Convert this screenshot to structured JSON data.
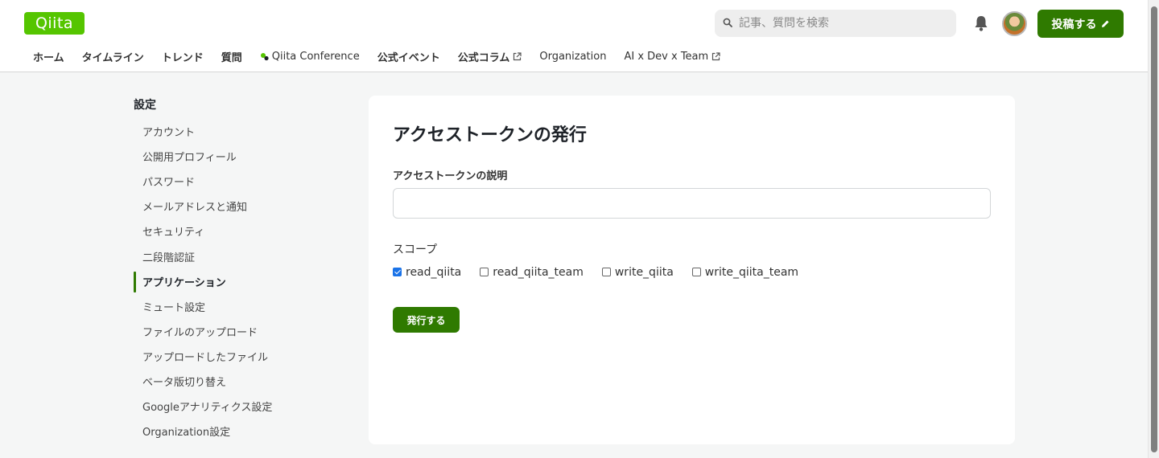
{
  "header": {
    "logo": "Qiita",
    "search_placeholder": "記事、質問を検索",
    "post_button_label": "投稿する"
  },
  "nav": {
    "items": [
      {
        "label": "ホーム"
      },
      {
        "label": "タイムライン"
      },
      {
        "label": "トレンド"
      },
      {
        "label": "質問"
      },
      {
        "label": "Qiita Conference"
      },
      {
        "label": "公式イベント"
      },
      {
        "label": "公式コラム"
      },
      {
        "label": "Organization"
      },
      {
        "label": "AI x Dev x Team"
      }
    ]
  },
  "sidebar": {
    "title": "設定",
    "items": [
      {
        "label": "アカウント"
      },
      {
        "label": "公開用プロフィール"
      },
      {
        "label": "パスワード"
      },
      {
        "label": "メールアドレスと通知"
      },
      {
        "label": "セキュリティ"
      },
      {
        "label": "二段階認証"
      },
      {
        "label": "アプリケーション",
        "active": true
      },
      {
        "label": "ミュート設定"
      },
      {
        "label": "ファイルのアップロード"
      },
      {
        "label": "アップロードしたファイル"
      },
      {
        "label": "ベータ版切り替え"
      },
      {
        "label": "Googleアナリティクス設定"
      },
      {
        "label": "Organization設定"
      }
    ]
  },
  "main": {
    "title": "アクセストークンの発行",
    "description_label": "アクセストークンの説明",
    "description_value": "",
    "scope_label": "スコープ",
    "scopes": [
      {
        "label": "read_qiita",
        "checked": true
      },
      {
        "label": "read_qiita_team",
        "checked": false
      },
      {
        "label": "write_qiita",
        "checked": false
      },
      {
        "label": "write_qiita_team",
        "checked": false
      }
    ],
    "submit_label": "発行する"
  },
  "colors": {
    "brand": "#55c500",
    "button": "#2f7a00",
    "background": "#f5f6f6"
  }
}
